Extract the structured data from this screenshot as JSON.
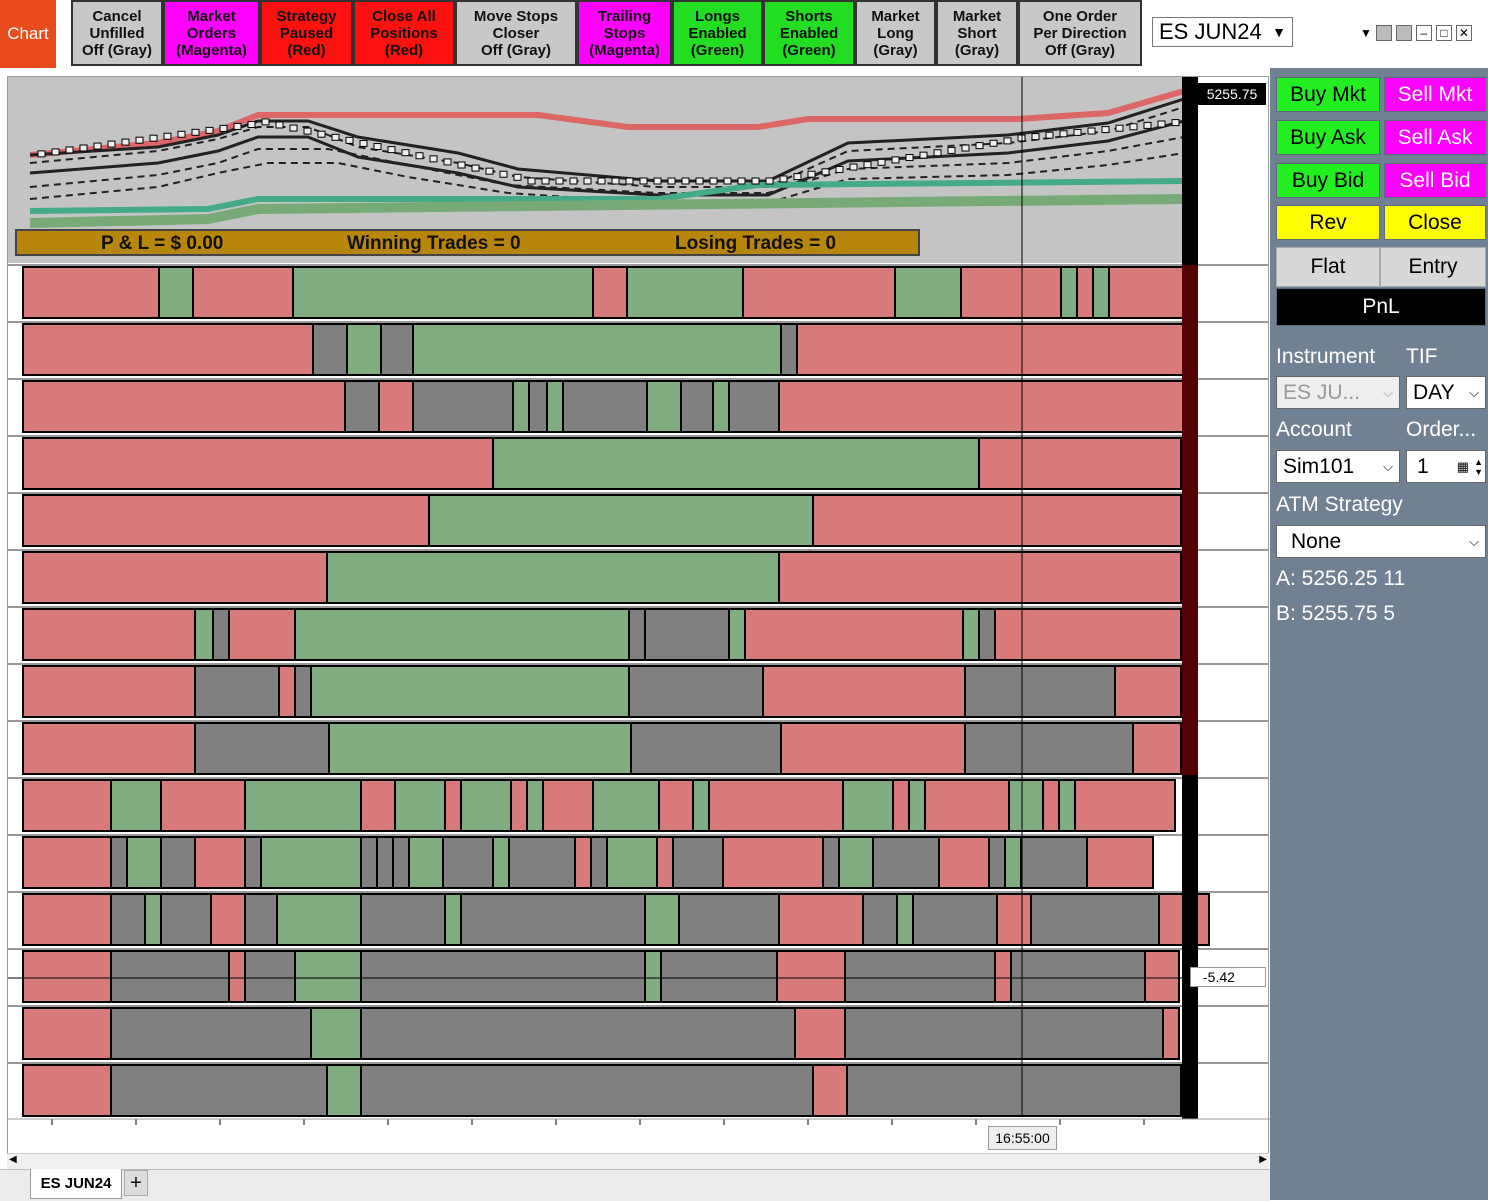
{
  "app": {
    "chart_tab_label": "Chart"
  },
  "toolbar": {
    "buttons": [
      {
        "label": "Cancel\nUnfilled\nOff (Gray)",
        "color": "#c8c8c8"
      },
      {
        "label": "Market\nOrders\n(Magenta)",
        "color": "#ff00ff"
      },
      {
        "label": "Strategy\nPaused\n(Red)",
        "color": "#ff1010"
      },
      {
        "label": "Close All\nPositions\n(Red)",
        "color": "#ff1010"
      },
      {
        "label": "Move Stops\nCloser\nOff (Gray)",
        "color": "#c8c8c8"
      },
      {
        "label": "Trailing\nStops\n(Magenta)",
        "color": "#ff00ff"
      },
      {
        "label": "Longs\nEnabled\n(Green)",
        "color": "#22dd22"
      },
      {
        "label": "Shorts\nEnabled\n(Green)",
        "color": "#22dd22"
      },
      {
        "label": "Market\nLong\n(Gray)",
        "color": "#c8c8c8"
      },
      {
        "label": "Market\nShort\n(Gray)",
        "color": "#c8c8c8"
      },
      {
        "label": "One Order\nPer Direction\nOff (Gray)",
        "color": "#c8c8c8"
      }
    ],
    "instrument": "ES JUN24"
  },
  "chart": {
    "price_label": "5255.75",
    "pnl_text": "P & L  =  $  0.00",
    "winning_text": "Winning Trades  =  0",
    "losing_text": "Losing Trades  =  0",
    "time_label": "16:55:00",
    "value_label": "-5.42",
    "colors": {
      "red": "#d97a7a",
      "green": "#7fad7f",
      "gray": "#808080",
      "pnl_bar": "#b8860b"
    }
  },
  "panel": {
    "buy_mkt": "Buy Mkt",
    "sell_mkt": "Sell Mkt",
    "buy_ask": "Buy Ask",
    "sell_ask": "Sell Ask",
    "buy_bid": "Buy Bid",
    "sell_bid": "Sell Bid",
    "rev": "Rev",
    "close": "Close",
    "flat": "Flat",
    "entry": "Entry",
    "pnl": "PnL",
    "instrument_label": "Instrument",
    "tif_label": "TIF",
    "instrument_value": "ES JU...",
    "tif_value": "DAY",
    "account_label": "Account",
    "order_label": "Order...",
    "account_value": "Sim101",
    "order_qty": "1",
    "atm_label": "ATM Strategy",
    "atm_value": "None",
    "ask_line": "A: 5256.25  11",
    "bid_line": "B: 5255.75  5"
  },
  "bottom": {
    "tab_label": "ES JUN24",
    "add_label": "+"
  }
}
